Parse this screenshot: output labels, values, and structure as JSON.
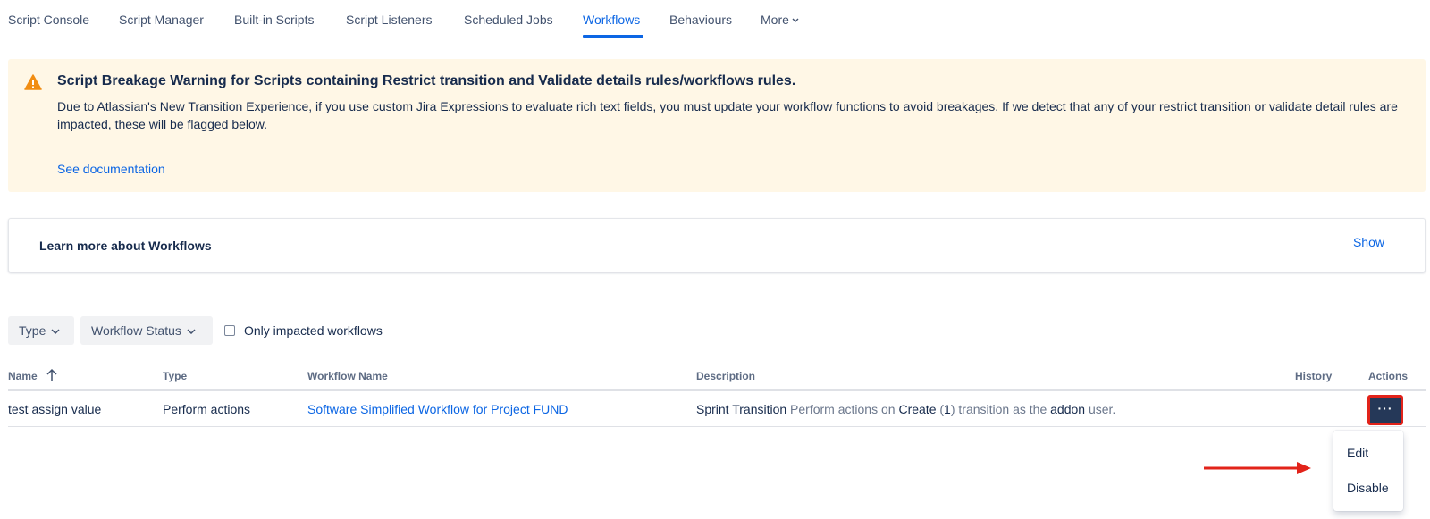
{
  "nav": {
    "tabs": [
      {
        "label": "Script Console"
      },
      {
        "label": "Script Manager"
      },
      {
        "label": "Built-in Scripts"
      },
      {
        "label": "Script Listeners"
      },
      {
        "label": "Scheduled Jobs"
      },
      {
        "label": "Workflows",
        "active": true
      },
      {
        "label": "Behaviours"
      },
      {
        "label": "More"
      }
    ],
    "more_icon": "chevron-down-icon"
  },
  "banner": {
    "icon": "warning-icon",
    "title": "Script Breakage Warning for Scripts containing Restrict transition and Validate details rules/workflows rules.",
    "body": "Due to Atlassian's New Transition Experience, if you use custom Jira Expressions to evaluate rich text fields, you must update your workflow functions to avoid breakages. If we detect that any of your restrict transition or validate detail rules are impacted, these will be flagged below.",
    "link": "See documentation",
    "background": "#fff7e6"
  },
  "learn_more": {
    "title": "Learn more about Workflows",
    "show": "Show"
  },
  "filters": {
    "type": "Type",
    "workflow_status": "Workflow Status",
    "only_impacted": "Only impacted workflows"
  },
  "table": {
    "columns": {
      "name": "Name",
      "type": "Type",
      "workflow_name": "Workflow Name",
      "description": "Description",
      "history": "History",
      "actions": "Actions"
    },
    "rows": [
      {
        "name": "test assign value",
        "type": "Perform actions",
        "workflow_name": "Software Simplified Workflow for Project FUND",
        "description": {
          "p1": "Sprint Transition",
          "p2": " Perform actions on ",
          "p3": "Create",
          "p4": " (",
          "p5": "1",
          "p6": ") transition as the ",
          "p7": "addon",
          "p8": " user."
        },
        "history": "",
        "actions_label": "···"
      }
    ]
  },
  "menu": {
    "items": [
      "Edit",
      "Disable"
    ]
  },
  "colors": {
    "link": "#0c66e4",
    "actions_bg": "#253858",
    "highlight": "#e2231a",
    "warning": "#f18d13"
  }
}
